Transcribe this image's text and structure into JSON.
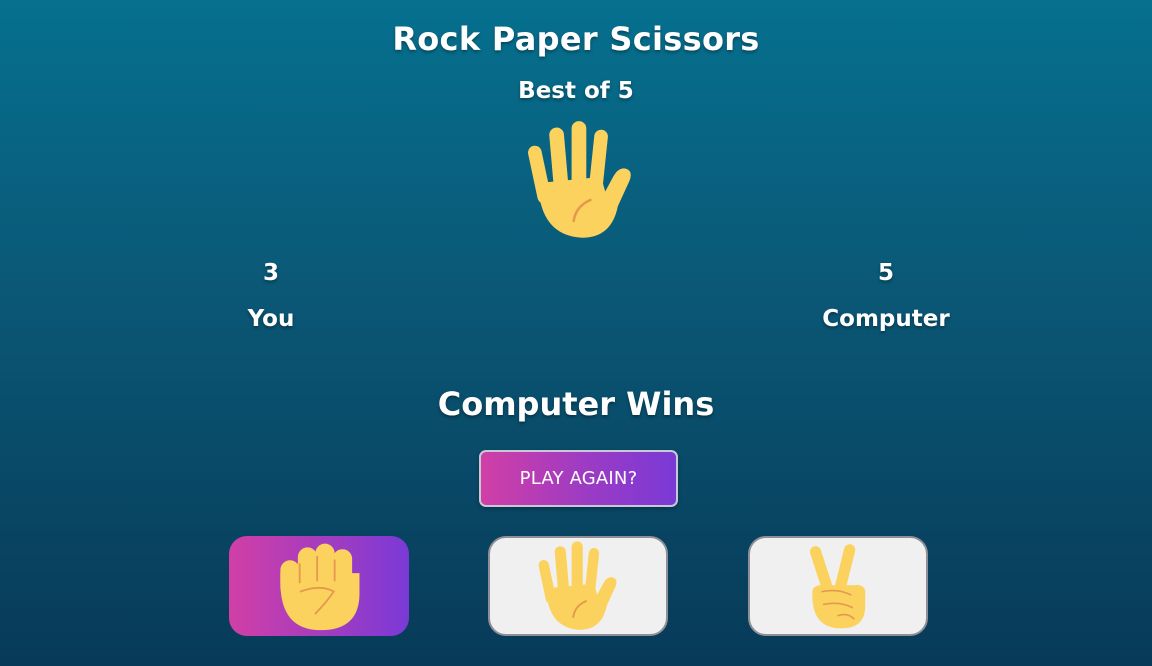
{
  "game": {
    "title": "Rock Paper Scissors",
    "subtitle": "Best of 5",
    "computer_choice": "paper-hand-icon"
  },
  "scores": {
    "player": {
      "value": "3",
      "label": "You"
    },
    "computer": {
      "value": "5",
      "label": "Computer"
    }
  },
  "result": {
    "text": "Computer Wins"
  },
  "controls": {
    "play_again_label": "PLAY AGAIN?"
  },
  "choices": [
    {
      "name": "rock",
      "icon": "fist-icon",
      "selected": true
    },
    {
      "name": "paper",
      "icon": "raised-hand-icon",
      "selected": false
    },
    {
      "name": "scissors",
      "icon": "victory-hand-icon",
      "selected": false
    }
  ],
  "colors": {
    "background_top": "#06708f",
    "background_bottom": "#073a58",
    "accent_start": "#d13fa6",
    "accent_end": "#7a3ad6",
    "hand_skin": "#fcd25e",
    "hand_line": "#e39a4e",
    "button_plain": "#f0f0f0"
  }
}
